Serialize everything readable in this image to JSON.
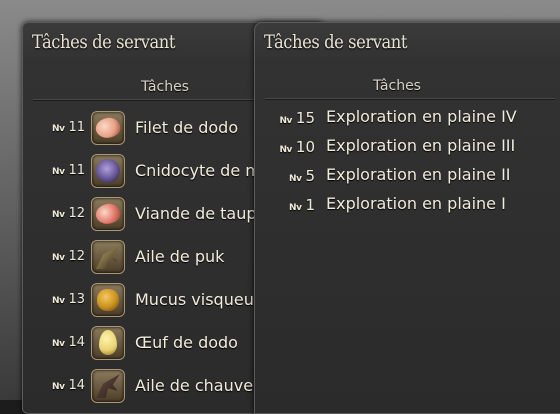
{
  "left_window": {
    "title": "Tâches de servant",
    "column_header": "Tâches",
    "level_prefix": "Nv",
    "rows": [
      {
        "level": "11",
        "name": "Filet de dodo",
        "icon": "meat-icon",
        "color": "#e8a085"
      },
      {
        "level": "11",
        "name": "Cnidocyte de m",
        "icon": "cnidocyte-icon",
        "color": "#6a5a9a"
      },
      {
        "level": "12",
        "name": "Viande de taup",
        "icon": "meat-icon",
        "color": "#e0786a"
      },
      {
        "level": "12",
        "name": "Aile de puk",
        "icon": "wing-icon",
        "color": "#c8b068"
      },
      {
        "level": "13",
        "name": "Mucus visqueu",
        "icon": "jar-icon",
        "color": "#c8901e"
      },
      {
        "level": "14",
        "name": "Œuf de dodo",
        "icon": "egg-icon",
        "color": "#e8d070"
      },
      {
        "level": "14",
        "name": "Aile de chauve",
        "icon": "bat-wing-icon",
        "color": "#6a4a48"
      }
    ]
  },
  "right_window": {
    "title": "Tâches de servant",
    "column_header": "Tâches",
    "level_prefix": "Nv",
    "rows": [
      {
        "level": "15",
        "name": "Exploration en plaine IV"
      },
      {
        "level": "10",
        "name": "Exploration en plaine III"
      },
      {
        "level": "5",
        "name": "Exploration en plaine II"
      },
      {
        "level": "1",
        "name": "Exploration en plaine I"
      }
    ]
  }
}
